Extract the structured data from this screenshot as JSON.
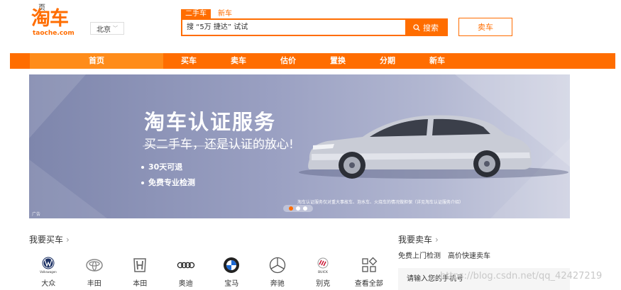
{
  "header": {
    "top_text": "页",
    "logo_main": "淘车",
    "logo_sub": "taoche.com",
    "city": "北京",
    "search_tabs": [
      "二手车",
      "新车"
    ],
    "search_placeholder": "搜 “5万 捷达” 试试",
    "search_button": "搜索",
    "sell_button": "卖车"
  },
  "nav": {
    "items": [
      "首页",
      "买车",
      "卖车",
      "估价",
      "置换",
      "分期",
      "新车"
    ]
  },
  "banner": {
    "title": "淘车认证服务",
    "subtitle": "买二手车，还是认证的放心!",
    "bullets": [
      "30天可退",
      "免费专业检测"
    ],
    "fine_print": "淘车认证服务仅对重大事故车、泡水车、火烧车的情况做担保（详见淘车认证服务介绍）",
    "ad_label": "广告"
  },
  "buy_section": {
    "title": "我要买车",
    "brands": [
      {
        "name": "大众",
        "icon": "volkswagen-logo"
      },
      {
        "name": "丰田",
        "icon": "toyota-logo"
      },
      {
        "name": "本田",
        "icon": "honda-logo"
      },
      {
        "name": "奥迪",
        "icon": "audi-logo"
      },
      {
        "name": "宝马",
        "icon": "bmw-logo"
      },
      {
        "name": "奔驰",
        "icon": "mercedes-logo"
      },
      {
        "name": "别克",
        "icon": "buick-logo"
      },
      {
        "name": "查看全部",
        "icon": "grid-icon"
      }
    ],
    "vw_logo_text": "Volkswagen",
    "buick_logo_text": "BUICK"
  },
  "sell_section": {
    "title": "我要卖车",
    "links": [
      "免费上门检测",
      "高价快速卖车"
    ],
    "phone_placeholder": "请输入您的手机号"
  },
  "watermark": "https://blog.csdn.net/qq_42427219",
  "colors": {
    "accent": "#ff6d00",
    "nav_home": "#ff8c1a"
  }
}
